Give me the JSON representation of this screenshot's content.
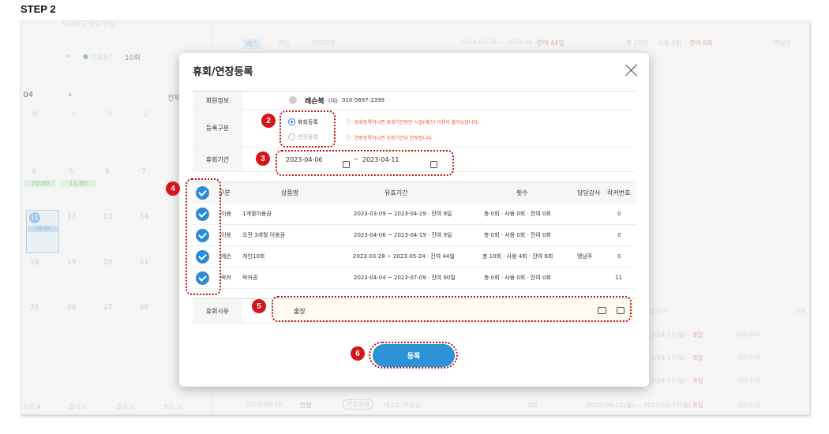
{
  "step_label": "STEP 2",
  "modal": {
    "title": "휴회/연장등록",
    "member": {
      "label": "회원정보",
      "name": "레슨북",
      "suffix": "(여)",
      "phone": "010-5697-2399"
    },
    "reg_type": {
      "label": "등록구분",
      "opt1": "휴회등록",
      "opt2": "연장등록",
      "warn1": "휴회등록하시면 휴회기간동안 시설(레슨) 이용이 불가능합니다.",
      "warn2": "연장등록하시면 이용기간이 연장됩니다."
    },
    "period": {
      "label": "휴회기간",
      "start": "2023-04-06",
      "sep": "~",
      "end": "2023-04-11"
    },
    "table": {
      "headers": {
        "type": "구분",
        "product": "상품명",
        "valid": "유효기간",
        "count": "횟수",
        "staff": "담당강사",
        "locker": "락커번호"
      },
      "rows": [
        {
          "type": "이용",
          "product": "1개월이용권",
          "valid": "2023-03-09 ~ 2023-04-19 · 잔여 9일",
          "count": "총 0회 · 사용 0회 · 잔여 0회",
          "staff": "",
          "locker": "0"
        },
        {
          "type": "이용",
          "product": "오전 3개월 이용권",
          "valid": "2023-04-06 ~ 2023-04-19 · 잔여 9일",
          "count": "총 0회 · 사용 0회 · 잔여 0회",
          "staff": "",
          "locker": "0"
        },
        {
          "type": "레슨",
          "product": "개인10회",
          "valid": "2023-03-28 ~ 2023-05-24 · 잔여 44일",
          "count": "총 10회 · 사용 4회 · 잔여 6회",
          "staff": "맹남주",
          "locker": "0"
        },
        {
          "type": "락커",
          "product": "락커권",
          "valid": "2023-04-04 ~ 2023-07-09 · 잔여 90일",
          "count": "총 0회 · 사용 0회 · 잔여 0회",
          "staff": "",
          "locker": "11"
        }
      ]
    },
    "reason": {
      "label": "휴회사유",
      "value": "출장"
    },
    "submit": "등록"
  },
  "badges": [
    "2",
    "3",
    "4",
    "5",
    "6"
  ],
  "background": {
    "breadcrumb": "도시환 > 양도 완원",
    "count_label": "이용횟수",
    "count_value": "10회",
    "month": ". 04",
    "all": "전체",
    "weekdays": [
      "화",
      "수",
      "목",
      "금"
    ],
    "dates_row1": [
      "4",
      "5",
      "6",
      "7"
    ],
    "dates_row2": [
      "11",
      "12",
      "13",
      "14"
    ],
    "dates_row3": [
      "18",
      "19",
      "20",
      "21"
    ],
    "dates_row4": [
      "25",
      "26",
      "27",
      "28"
    ],
    "time1": "20:00",
    "time2": "11:00",
    "time3": "09:00",
    "top_row": {
      "tag": "레슨",
      "name": "개인10회",
      "dates": "2023-03-28 ~ 2023-05-24",
      "left": "잔여 44일",
      "count": "총 10회",
      "used": "사용 4회",
      "remain": "잔여 6회",
      "staff": "맹남주"
    },
    "right_header": "사유",
    "right_period": "장기간",
    "right_rows": [
      {
        "date": "3-04-17(월)",
        "days": "8일",
        "reason": "내부수리"
      },
      {
        "date": "3-04-17(월)",
        "days": "8일",
        "reason": "내부수리"
      },
      {
        "date": "3-04-17(월)",
        "days": "8일",
        "reason": "내부수리"
      },
      {
        "date": "3-04-17(월)",
        "days": "8일",
        "reason": "내부수리"
      }
    ],
    "bottom_row": {
      "date": "2023-04-10",
      "tag": "연장",
      "tag2": "연장완료",
      "name": "테스트 이용권",
      "count": "1회",
      "range": "2023-04-10(월) ~ 2023-04-17(월)",
      "days": "8일",
      "reason": "내부수리"
    },
    "bottom_left": [
      "완료 4",
      "결석 0",
      "결석 0",
      "취소 3"
    ]
  },
  "colors": {
    "primary": "#2c93d9",
    "badge": "#d4161a",
    "warn": "#e05a3a"
  }
}
